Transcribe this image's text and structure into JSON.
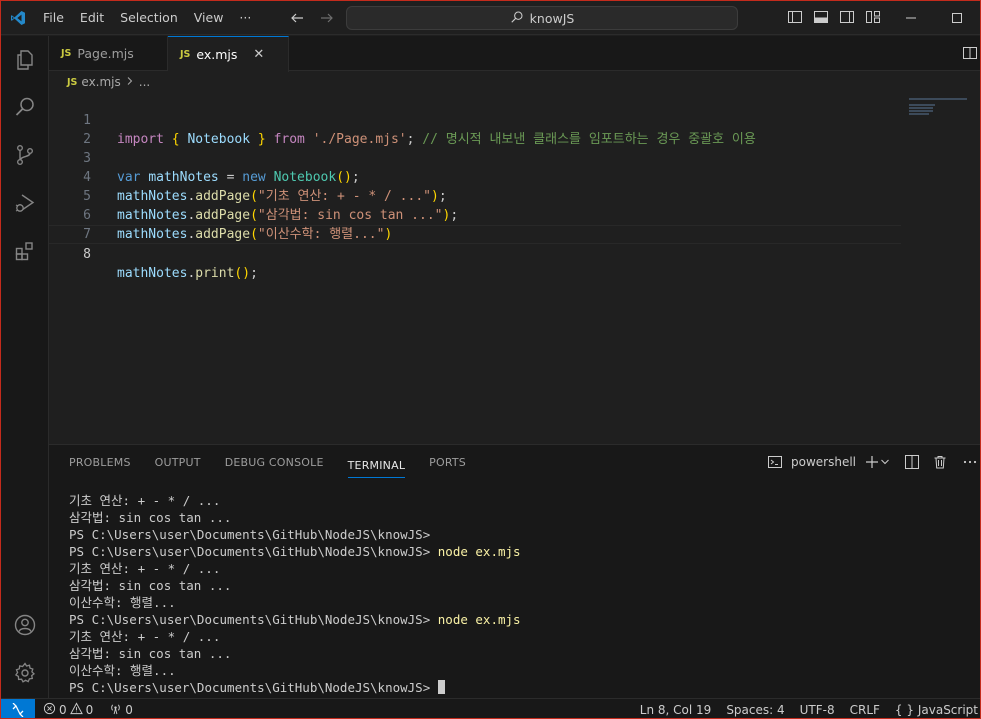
{
  "titlebar": {
    "menu": [
      "File",
      "Edit",
      "Selection",
      "View",
      "···"
    ],
    "search_text": "knowJS"
  },
  "tabs": [
    {
      "label": "Page.mjs",
      "badge": "JS"
    },
    {
      "label": "ex.mjs",
      "badge": "JS",
      "close": "✕"
    }
  ],
  "breadcrumb": {
    "file": "ex.mjs",
    "badge": "JS",
    "rest": "..."
  },
  "editor": {
    "line_numbers": [
      "1",
      "2",
      "3",
      "4",
      "5",
      "6",
      "7",
      "8"
    ],
    "line1": {
      "import": "import",
      "brace_open": "{",
      "name": "Notebook",
      "brace_close": "}",
      "from": "from",
      "path": "'./Page.mjs'",
      "semi": ";",
      "comment": "// 명시적 내보낸 클래스를 임포트하는 경우 중괄호 이용"
    },
    "line3": {
      "var": "var",
      "name": "mathNotes",
      "eq": " = ",
      "new": "new",
      "cls": "Notebook",
      "paren": "()",
      "semi": ";"
    },
    "line4": {
      "obj": "mathNotes",
      "dot": ".",
      "fn": "addPage",
      "open": "(",
      "str": "\"기초 연산: + - * / ...\"",
      "close": ")",
      "semi": ";"
    },
    "line5": {
      "obj": "mathNotes",
      "dot": ".",
      "fn": "addPage",
      "open": "(",
      "str": "\"삼각법: sin cos tan ...\"",
      "close": ")",
      "semi": ";"
    },
    "line6": {
      "obj": "mathNotes",
      "dot": ".",
      "fn": "addPage",
      "open": "(",
      "str": "\"이산수학: 행렬...\"",
      "close": ")"
    },
    "line8": {
      "obj": "mathNotes",
      "dot": ".",
      "fn": "print",
      "paren": "()",
      "semi": ";"
    }
  },
  "panel": {
    "tabs": [
      "PROBLEMS",
      "OUTPUT",
      "DEBUG CONSOLE",
      "TERMINAL",
      "PORTS"
    ],
    "shell": "powershell",
    "terminal_lines": [
      {
        "text": "기초 연산: + - * / ...",
        "cmd": ""
      },
      {
        "text": "삼각법: sin cos tan ...",
        "cmd": ""
      },
      {
        "text": "PS C:\\Users\\user\\Documents\\GitHub\\NodeJS\\knowJS>",
        "cmd": ""
      },
      {
        "text": "PS C:\\Users\\user\\Documents\\GitHub\\NodeJS\\knowJS> ",
        "cmd": "node ex.mjs"
      },
      {
        "text": "기초 연산: + - * / ...",
        "cmd": ""
      },
      {
        "text": "삼각법: sin cos tan ...",
        "cmd": ""
      },
      {
        "text": "이산수학: 행렬...",
        "cmd": ""
      },
      {
        "text": "PS C:\\Users\\user\\Documents\\GitHub\\NodeJS\\knowJS> ",
        "cmd": "node ex.mjs"
      },
      {
        "text": "기초 연산: + - * / ...",
        "cmd": ""
      },
      {
        "text": "삼각법: sin cos tan ...",
        "cmd": ""
      },
      {
        "text": "이산수학: 행렬...",
        "cmd": ""
      },
      {
        "text": "PS C:\\Users\\user\\Documents\\GitHub\\NodeJS\\knowJS> ",
        "cmd": ""
      }
    ]
  },
  "statusbar": {
    "errors": "0",
    "warnings": "0",
    "ports": "0",
    "position": "Ln 8, Col 19",
    "spaces": "Spaces: 4",
    "encoding": "UTF-8",
    "eol": "CRLF",
    "language_brace": "{ }",
    "language": "JavaScript"
  },
  "colors": {
    "accent": "#0078d4",
    "border": "#c42b1c",
    "js_badge": "#cbcb41"
  }
}
